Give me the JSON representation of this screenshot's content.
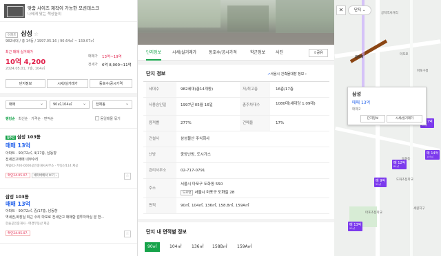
{
  "ad": {
    "title": "맞춤 사이즈 제작이 가능한 모션데스크",
    "subtitle": "나에게 맞는 책상높이"
  },
  "apt": {
    "type_tag": "아파트",
    "name": "삼성",
    "meta": "982세대 / 총 14동 / 1997.05.16 / 90.64㎡ ~ 159.07㎡",
    "recent_label": "최근 매매 실거래가",
    "recent_price": "10억 4,200",
    "recent_date": "2024.05.01, 7층, 104㎡",
    "sale_label": "매매가",
    "sale_range": "13억~19억",
    "rent_label": "전세가",
    "rent_range": "6억 8,000~11억"
  },
  "left_buttons": [
    "단지정보",
    "시세/실거래가",
    "동호수/공시가격"
  ],
  "filters": {
    "trade": "매매",
    "area": "90㎡,104㎡",
    "dong": "전체동"
  },
  "sort": {
    "items": [
      "랭킹순",
      "최신순",
      "가격순",
      "면적순"
    ],
    "group_label": "동일매물 묶기"
  },
  "listings": [
    {
      "badge": "집주인",
      "title": "삼성 103동",
      "price": "매매 13억",
      "info": "아파트 · 90/72㎡, 4/17층, 남동향",
      "desc": "전세안고매매 내부수리",
      "agent": "계림02-700-0000공인중개사사무소 · 부동산114 제공",
      "confirm": "확인24.05.07.",
      "naver": "네이버에서 보기"
    },
    {
      "badge": "",
      "title": "삼성 103동",
      "price": "매매 13억",
      "info": "아파트 · 90/72㎡, 중/17층, 남동향",
      "desc": "역세권,화장실 최근 수리 마포로 전세안고 매매함 갭투자하실 분 환...",
      "agent": "한솔공인중개사 · 매경부동산 제공",
      "confirm": "확인24.05.07.",
      "naver": ""
    }
  ],
  "middle": {
    "tabs": [
      "단지정보",
      "시세/실거래가",
      "동호수/공시가격",
      "학군정보",
      "사진"
    ],
    "share": "공유",
    "section_title": "단지 정보",
    "ledger_link": "서울시 건축물대장 정보",
    "rows": [
      {
        "k": "세대수",
        "v": "982세대(총14개동)",
        "k2": "저/최고층",
        "v2": "16층/17층"
      },
      {
        "k": "사용승인일",
        "v": "1997년 05월 16일",
        "k2": "총주차대수",
        "v2": "1080대(세대당 1.09대)"
      },
      {
        "k": "용적률",
        "v": "277%",
        "k2": "건폐율",
        "v2": "17%"
      },
      {
        "k": "건설사",
        "v": "삼성물산 주식회사",
        "k2": "",
        "v2": ""
      },
      {
        "k": "난방",
        "v": "중앙난방, 도시가스",
        "k2": "",
        "v2": ""
      },
      {
        "k": "관리사무소",
        "v": "02-717-0791",
        "k2": "",
        "v2": ""
      },
      {
        "k": "주소",
        "v": "서울시 마포구 도화동 550",
        "k2": "",
        "v2": ""
      },
      {
        "k": "면적",
        "v": "90㎡, 104㎡, 136㎡, 158.8㎡, 159A㎡",
        "k2": "",
        "v2": ""
      }
    ],
    "road_addr_tag": "도로명",
    "road_addr": "서울시 마포구 도화길 28",
    "area_section_title": "단지 내 면적별 정보",
    "area_tabs": [
      "90㎡",
      "104㎡",
      "136㎡",
      "158B㎡",
      "159A㎡"
    ]
  },
  "map": {
    "filter_label": "단지",
    "popup": {
      "name": "삼성",
      "price": "매매 13억",
      "sub": "매매2",
      "btn1": "단지정보",
      "btn2": "시세/실거래가"
    },
    "labels": [
      "공덕역사거리",
      "마포로",
      "공덕역",
      "마포구청",
      "도화동",
      "도화초등학교",
      "마포초등학교",
      "세원지구"
    ],
    "markers": [
      {
        "price": "10.7억",
        "sub": "90㎡"
      },
      {
        "price": "매 14억",
        "sub": "105㎡"
      },
      {
        "price": "매 12억",
        "sub": "84㎡"
      },
      {
        "price": "매 9억",
        "sub": "59㎡"
      },
      {
        "price": "매 13억",
        "sub": "90㎡"
      }
    ]
  }
}
